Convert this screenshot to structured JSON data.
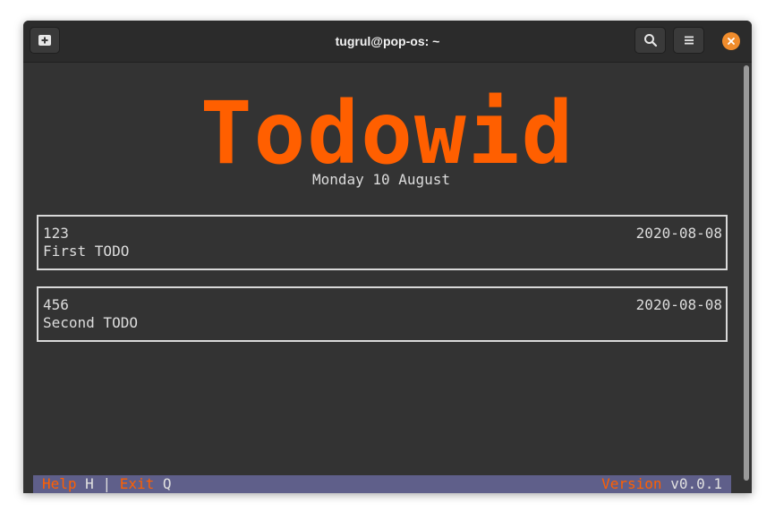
{
  "window": {
    "title": "tugrul@pop-os: ~"
  },
  "icons": {
    "new_tab": "new-tab-icon",
    "search": "search-icon",
    "menu": "hamburger-menu-icon",
    "close": "close-icon"
  },
  "app": {
    "logo": "Todowid",
    "date": "Monday 10 August"
  },
  "todos": [
    {
      "id": "123",
      "date": "2020-08-08",
      "text": "First TODO"
    },
    {
      "id": "456",
      "date": "2020-08-08",
      "text": "Second TODO"
    }
  ],
  "statusbar": {
    "help_label": "Help",
    "help_key": "H",
    "separator": "|",
    "exit_label": "Exit",
    "exit_key": "Q",
    "version_label": "Version",
    "version_value": "v0.0.1"
  },
  "colors": {
    "accent": "#ff5f00",
    "background": "#333333",
    "statusbar": "#5f5f8a",
    "close_button": "#f08c2c"
  }
}
